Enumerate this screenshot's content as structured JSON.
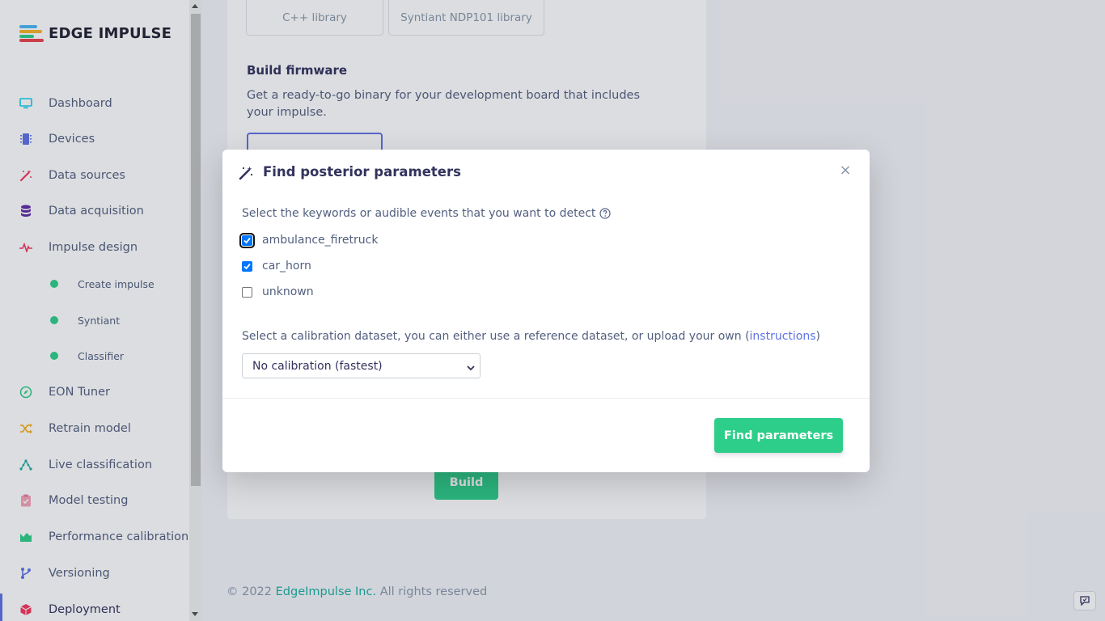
{
  "brand": {
    "name": "EDGE IMPULSE",
    "logo_colors": [
      "#4bb8f2",
      "#f5b428",
      "#e8434f",
      "#2dce89"
    ]
  },
  "sidebar": {
    "items": [
      {
        "label": "Dashboard",
        "icon": "monitor-icon",
        "color": "#11cdef"
      },
      {
        "label": "Devices",
        "icon": "chip-icon",
        "color": "#5e72e4"
      },
      {
        "label": "Data sources",
        "icon": "magic-wand-icon",
        "color": "#f5365c"
      },
      {
        "label": "Data acquisition",
        "icon": "database-icon",
        "color": "#5e2ca5"
      },
      {
        "label": "Impulse design",
        "icon": "pulse-icon",
        "color": "#f5365c"
      },
      {
        "label": "Create impulse",
        "icon": "dot-icon",
        "color": "#2dce89"
      },
      {
        "label": "Syntiant",
        "icon": "dot-icon",
        "color": "#2dce89"
      },
      {
        "label": "Classifier",
        "icon": "dot-icon",
        "color": "#2dce89"
      },
      {
        "label": "EON Tuner",
        "icon": "compass-icon",
        "color": "#2dce89"
      },
      {
        "label": "Retrain model",
        "icon": "shuffle-icon",
        "color": "#f5b428"
      },
      {
        "label": "Live classification",
        "icon": "network-icon",
        "color": "#1aae9f"
      },
      {
        "label": "Model testing",
        "icon": "clipboard-check-icon",
        "color": "#f3a4b5"
      },
      {
        "label": "Performance calibration",
        "icon": "area-chart-icon",
        "color": "#2dce89"
      },
      {
        "label": "Versioning",
        "icon": "branch-icon",
        "color": "#5e72e4"
      },
      {
        "label": "Deployment",
        "icon": "cube-icon",
        "color": "#f5365c"
      }
    ]
  },
  "main": {
    "library_buttons": [
      "C++ library",
      "Syntiant NDP101 library"
    ],
    "build_firmware": {
      "title": "Build firmware",
      "description": "Get a ready-to-go binary for your development board that includes your impulse."
    },
    "build_label": "Build"
  },
  "footer": {
    "copyright": "© 2022",
    "company": "EdgeImpulse Inc.",
    "rights": "All rights reserved"
  },
  "modal": {
    "title": "Find posterior parameters",
    "close": "×",
    "prompt": "Select the keywords or audible events that you want to detect",
    "keywords": [
      {
        "label": "ambulance_firetruck",
        "checked": true
      },
      {
        "label": "car_horn",
        "checked": true
      },
      {
        "label": "unknown",
        "checked": false
      }
    ],
    "calibration_text_pre": "Select a calibration dataset, you can either use a reference dataset, or upload your own (",
    "calibration_link": "instructions",
    "calibration_text_post": ")",
    "calibration_selected": "No calibration (fastest)",
    "submit": "Find parameters"
  }
}
